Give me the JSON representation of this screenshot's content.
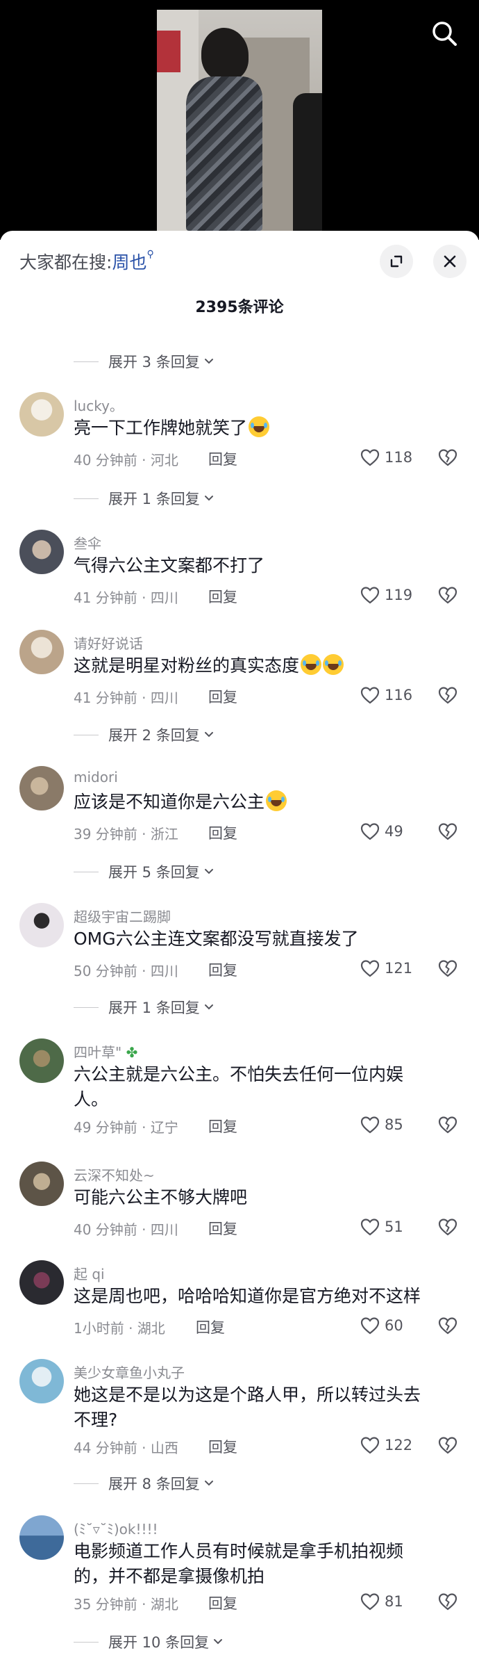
{
  "search_bar": {
    "prefix": "大家都在搜:",
    "keyword": "周也"
  },
  "comments_title": "2395条评论",
  "replies": [
    {
      "text": "展开 3 条回复"
    },
    {
      "text": "展开 1 条回复"
    },
    {
      "text": "展开 2 条回复"
    },
    {
      "text": "展开 5 条回复"
    },
    {
      "text": "展开 1 条回复"
    },
    {
      "text": "展开 8 条回复"
    },
    {
      "text": "展开 10 条回复"
    }
  ],
  "comments": [
    {
      "username": "lucky。",
      "text": "亮一下工作牌她就笑了",
      "meta": "40 分钟前 · 河北",
      "reply_label": "回复",
      "likes": "118",
      "avatar_color": "#d8c7a6"
    },
    {
      "username": "叁伞",
      "text": "气得六公主文案都不打了",
      "meta": "41 分钟前 · 四川",
      "reply_label": "回复",
      "likes": "119",
      "avatar_color": "#4b4f5a"
    },
    {
      "username": "请好好说话",
      "text": "这就是明星对粉丝的真实态度",
      "meta": "41 分钟前 · 四川",
      "reply_label": "回复",
      "likes": "116",
      "avatar_color": "#bba48a"
    },
    {
      "username": "midori",
      "text": "应该是不知道你是六公主",
      "meta": "39 分钟前 · 浙江",
      "reply_label": "回复",
      "likes": "49",
      "avatar_color": "#8a7a68"
    },
    {
      "username": "超级宇宙二踢脚",
      "text": "OMG六公主连文案都没写就直接发了",
      "meta": "50 分钟前 · 四川",
      "reply_label": "回复",
      "likes": "121",
      "avatar_color": "#e9e4ea"
    },
    {
      "username": "四叶草\"",
      "text": "六公主就是六公主。不怕失去任何一位内娱人。",
      "meta": "49 分钟前 · 辽宁",
      "reply_label": "回复",
      "likes": "85",
      "avatar_color": "#4e6a48"
    },
    {
      "username": "云深不知处~",
      "text": "可能六公主不够大牌吧",
      "meta": "40 分钟前 · 四川",
      "reply_label": "回复",
      "likes": "51",
      "avatar_color": "#5d5447"
    },
    {
      "username": "起 qi",
      "text": "这是周也吧，哈哈哈知道你是官方绝对不这样",
      "meta": "1小时前 · 湖北",
      "reply_label": "回复",
      "likes": "60",
      "avatar_color": "#2a2a30"
    },
    {
      "username": "美少女章鱼小丸子",
      "text": "她这是不是以为这是个路人甲，所以转过头去不理?",
      "meta": "44 分钟前 · 山西",
      "reply_label": "回复",
      "likes": "122",
      "avatar_color": "#7fb8d6"
    },
    {
      "username": "(ﾐ˘▿˘ﾐ)ok!!!!",
      "text": "电影频道工作人员有时候就是拿手机拍视频的，并不都是拿摄像机拍",
      "meta": "35 分钟前 · 湖北",
      "reply_label": "回复",
      "likes": "81",
      "avatar_color": "#3e6a9a"
    }
  ],
  "icons": {
    "search": "search-icon",
    "expand": "expand-icon",
    "close": "close-icon",
    "like": "heart-icon",
    "dislike": "broken-heart-icon",
    "chevron": "chevron-down-icon"
  },
  "colors": {
    "keyword": "#2a52a8",
    "text": "#161823",
    "muted": "#8a8b91"
  }
}
